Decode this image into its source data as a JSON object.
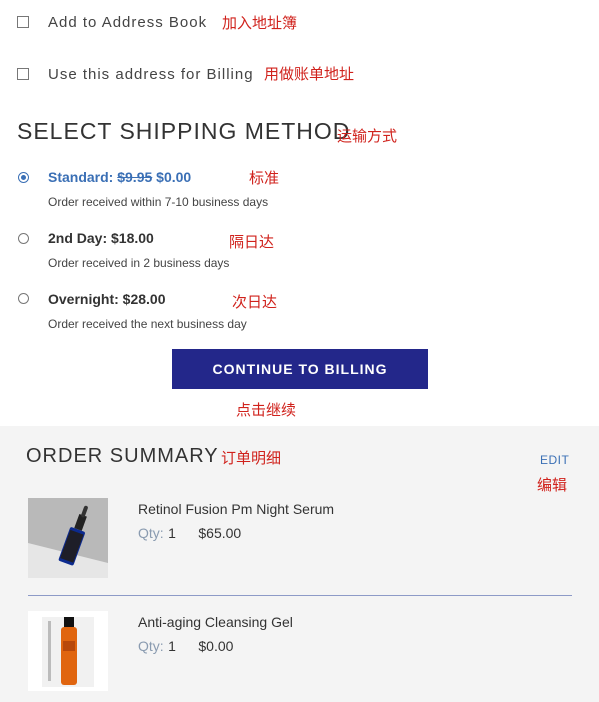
{
  "checkboxes": {
    "address_book": {
      "label": "Add to Address Book",
      "anno": "加入地址簿"
    },
    "billing": {
      "label": "Use this address for Billing",
      "anno": "用做账单地址"
    }
  },
  "shipping": {
    "title": "SELECT SHIPPING METHOD",
    "title_anno": "运输方式",
    "options": [
      {
        "name": "Standard:",
        "old_price": "$9.95",
        "price": "$0.00",
        "desc": "Order received within 7-10 business days",
        "anno": "标准",
        "selected": true
      },
      {
        "name": "2nd Day:",
        "price": "$18.00",
        "desc": "Order received in 2 business days",
        "anno": "隔日达",
        "selected": false
      },
      {
        "name": "Overnight:",
        "price": "$28.00",
        "desc": "Order received the next business day",
        "anno": "次日达",
        "selected": false
      }
    ]
  },
  "continue_button": {
    "label": "CONTINUE TO BILLING",
    "anno": "点击继续"
  },
  "summary": {
    "title": "ORDER SUMMARY",
    "title_anno": "订单明细",
    "edit_label": "EDIT",
    "edit_anno": "编辑",
    "items": [
      {
        "name": "Retinol Fusion Pm Night Serum",
        "qty_label": "Qty:",
        "qty": "1",
        "price": "$65.00",
        "image": "serum-dropper-bottle"
      },
      {
        "name": "Anti-aging Cleansing Gel",
        "qty_label": "Qty:",
        "qty": "1",
        "price": "$0.00",
        "image": "orange-gel-bottle"
      }
    ]
  },
  "colors": {
    "accent": "#3a6fb5",
    "button": "#23278a",
    "annotation": "#d0221c",
    "summary_bg": "#f4f4f4"
  }
}
